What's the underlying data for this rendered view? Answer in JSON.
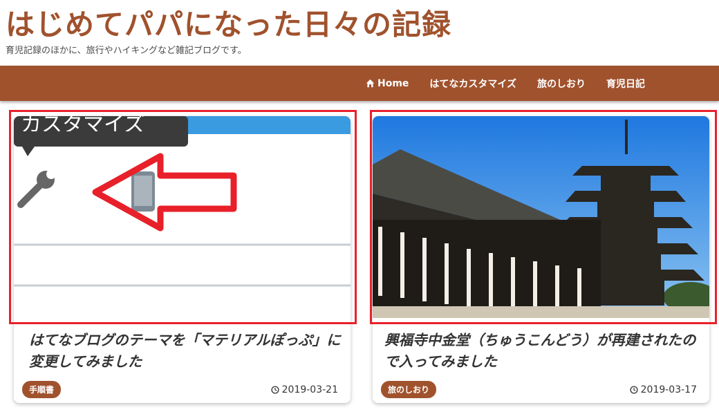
{
  "header": {
    "title": "はじめてパパになった日々の記録",
    "description": "育児記録のほかに、旅行やハイキングなど雑記ブログです。"
  },
  "nav": {
    "items": [
      {
        "label": "Home",
        "icon": "home-icon"
      },
      {
        "label": "はてなカスタマイズ"
      },
      {
        "label": "旅のしおり"
      },
      {
        "label": "育児日記"
      }
    ]
  },
  "colors": {
    "brand": "#a0522d",
    "highlight": "#e8202a"
  },
  "posts": [
    {
      "title": "はてなブログのテーマを「マテリアルぽっぷ」に変更してみました",
      "category": "手順書",
      "date": "2019-03-21",
      "thumbnail_text": "カスタマイズ",
      "thumbnail_icon": "wrench-icon"
    },
    {
      "title": "興福寺中金堂（ちゅうこんどう）が再建されたので入ってみました",
      "category": "旅のしおり",
      "date": "2019-03-17"
    }
  ]
}
